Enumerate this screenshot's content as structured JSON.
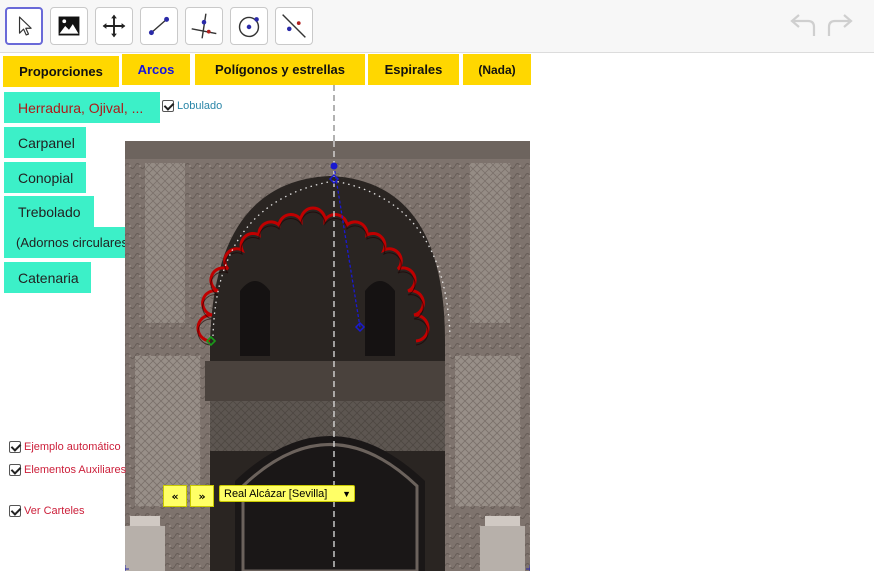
{
  "toolbar": {
    "tools": [
      {
        "name": "move-tool",
        "icon": "arrow-cursor-icon"
      },
      {
        "name": "image-tool",
        "icon": "image-icon"
      },
      {
        "name": "move-view-tool",
        "icon": "move-arrows-icon"
      },
      {
        "name": "segment-tool",
        "icon": "segment-icon"
      },
      {
        "name": "perpendicular-tool",
        "icon": "perpendicular-icon"
      },
      {
        "name": "circle-tool",
        "icon": "circle-center-point-icon"
      },
      {
        "name": "line-tool",
        "icon": "line-icon"
      }
    ],
    "undo_icon": "undo-icon",
    "redo_icon": "redo-icon"
  },
  "tabs": [
    {
      "label": "Proporciones"
    },
    {
      "label": "Arcos"
    },
    {
      "label": "Polígonos y estrellas"
    },
    {
      "label": "Espirales"
    },
    {
      "label": "(Nada)"
    }
  ],
  "arc_types": [
    {
      "label": "Herradura, Ojival, ..."
    },
    {
      "label": "Carpanel"
    },
    {
      "label": "Conopial"
    },
    {
      "label": "Trebolado"
    },
    {
      "label": "(Adornos circulares)"
    },
    {
      "label": "Catenaria"
    }
  ],
  "checkboxes": {
    "lobulado": {
      "label": "Lobulado",
      "checked": true
    },
    "ejemplo": {
      "label": "Ejemplo automático",
      "checked": true
    },
    "auxiliares": {
      "label": "Elementos Auxiliares",
      "checked": true
    },
    "carteles": {
      "label": "Ver Carteles",
      "checked": true
    }
  },
  "nav": {
    "prev_label": "«",
    "next_label": "»"
  },
  "example_select": {
    "value": "Real Alcázar [Sevilla]"
  },
  "colors": {
    "tab_bg": "#ffd700",
    "active_tab_text": "#1515e0",
    "arc_button_bg": "#3cf0c8",
    "arc_active_text": "#b01818",
    "lobulado_text": "#2a86a8",
    "checkbox_text": "#cc1f3a",
    "arch_curve": "#c00000",
    "radius_line": "#1a1ad0",
    "start_point": "#1a9a1a"
  }
}
